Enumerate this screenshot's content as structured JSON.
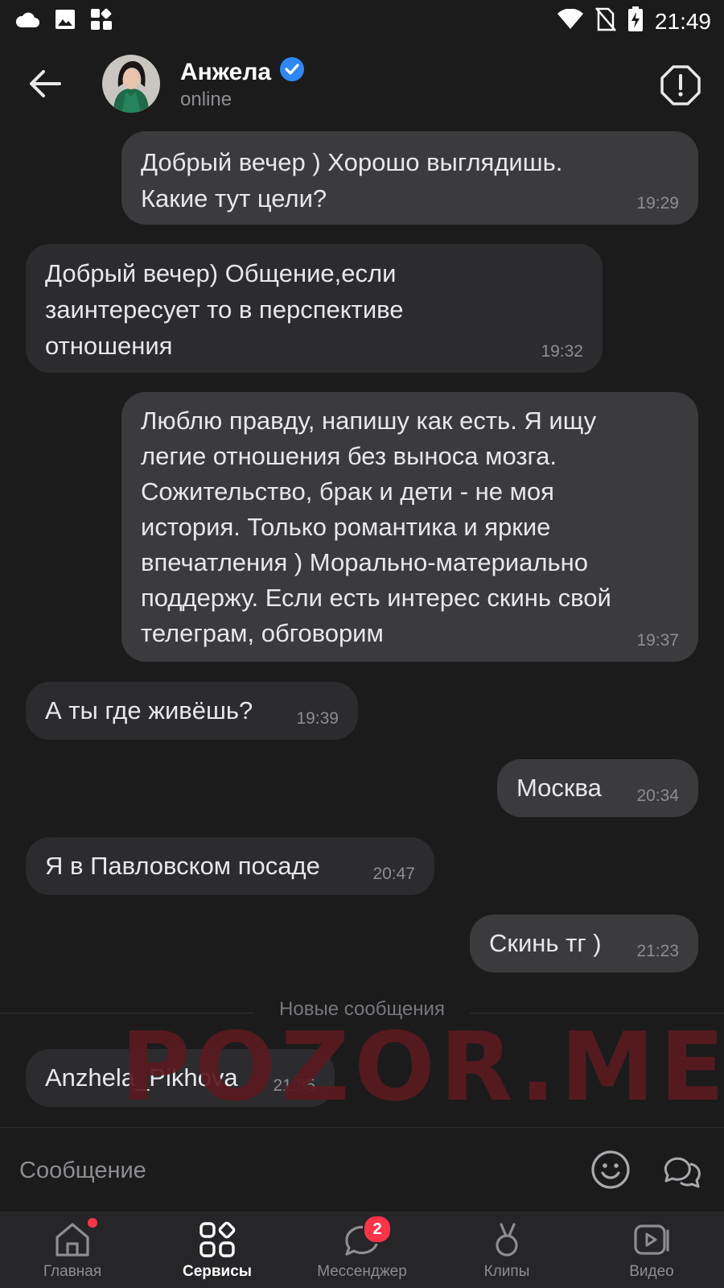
{
  "status_bar": {
    "time": "21:49"
  },
  "header": {
    "name": "Анжела",
    "status": "online"
  },
  "messages": [
    {
      "dir": "out",
      "text": "Добрый вечер ) Хорошо выглядишь.\nКакие тут цели?",
      "time": "19:29"
    },
    {
      "dir": "in",
      "text": "Добрый вечер) Общение,если\nзаинтересует то в перспективе\nотношения",
      "time": "19:32"
    },
    {
      "dir": "out",
      "text": "Люблю правду, напишу как есть. Я ищу\nлегие отношения без выноса мозга.\nСожительство, брак и дети - не моя\nистория. Только романтика и яркие\nвпечатления ) Морально-материально\nподдержу. Если есть интерес скинь свой\nтелеграм, обговорим",
      "time": "19:37"
    },
    {
      "dir": "in",
      "text": "А ты где живёшь?",
      "time": "19:39"
    },
    {
      "dir": "out",
      "text": "Москва",
      "time": "20:34"
    },
    {
      "dir": "in",
      "text": "Я в Павловском посаде",
      "time": "20:47"
    },
    {
      "dir": "out",
      "text": "Скинь тг )",
      "time": "21:23"
    }
  ],
  "new_messages_label": "Новые сообщения",
  "new_messages": [
    {
      "dir": "in",
      "text": "Anzhela_Pikhova",
      "time": "21:35"
    }
  ],
  "watermark": "POZOR.ME",
  "composer": {
    "placeholder": "Сообщение"
  },
  "tabs": [
    {
      "label": "Главная",
      "icon": "home-icon",
      "dot": true
    },
    {
      "label": "Сервисы",
      "icon": "services-icon",
      "active": true
    },
    {
      "label": "Мессенджер",
      "icon": "messenger-icon",
      "badge": "2"
    },
    {
      "label": "Клипы",
      "icon": "clips-icon"
    },
    {
      "label": "Видео",
      "icon": "video-icon"
    }
  ],
  "colors": {
    "background": "#1b1b1c",
    "bubble_out": "#3b3b3d",
    "bubble_in": "#2c2c2e",
    "accent_blue": "#2f87f6",
    "badge_red": "#ff3347"
  }
}
